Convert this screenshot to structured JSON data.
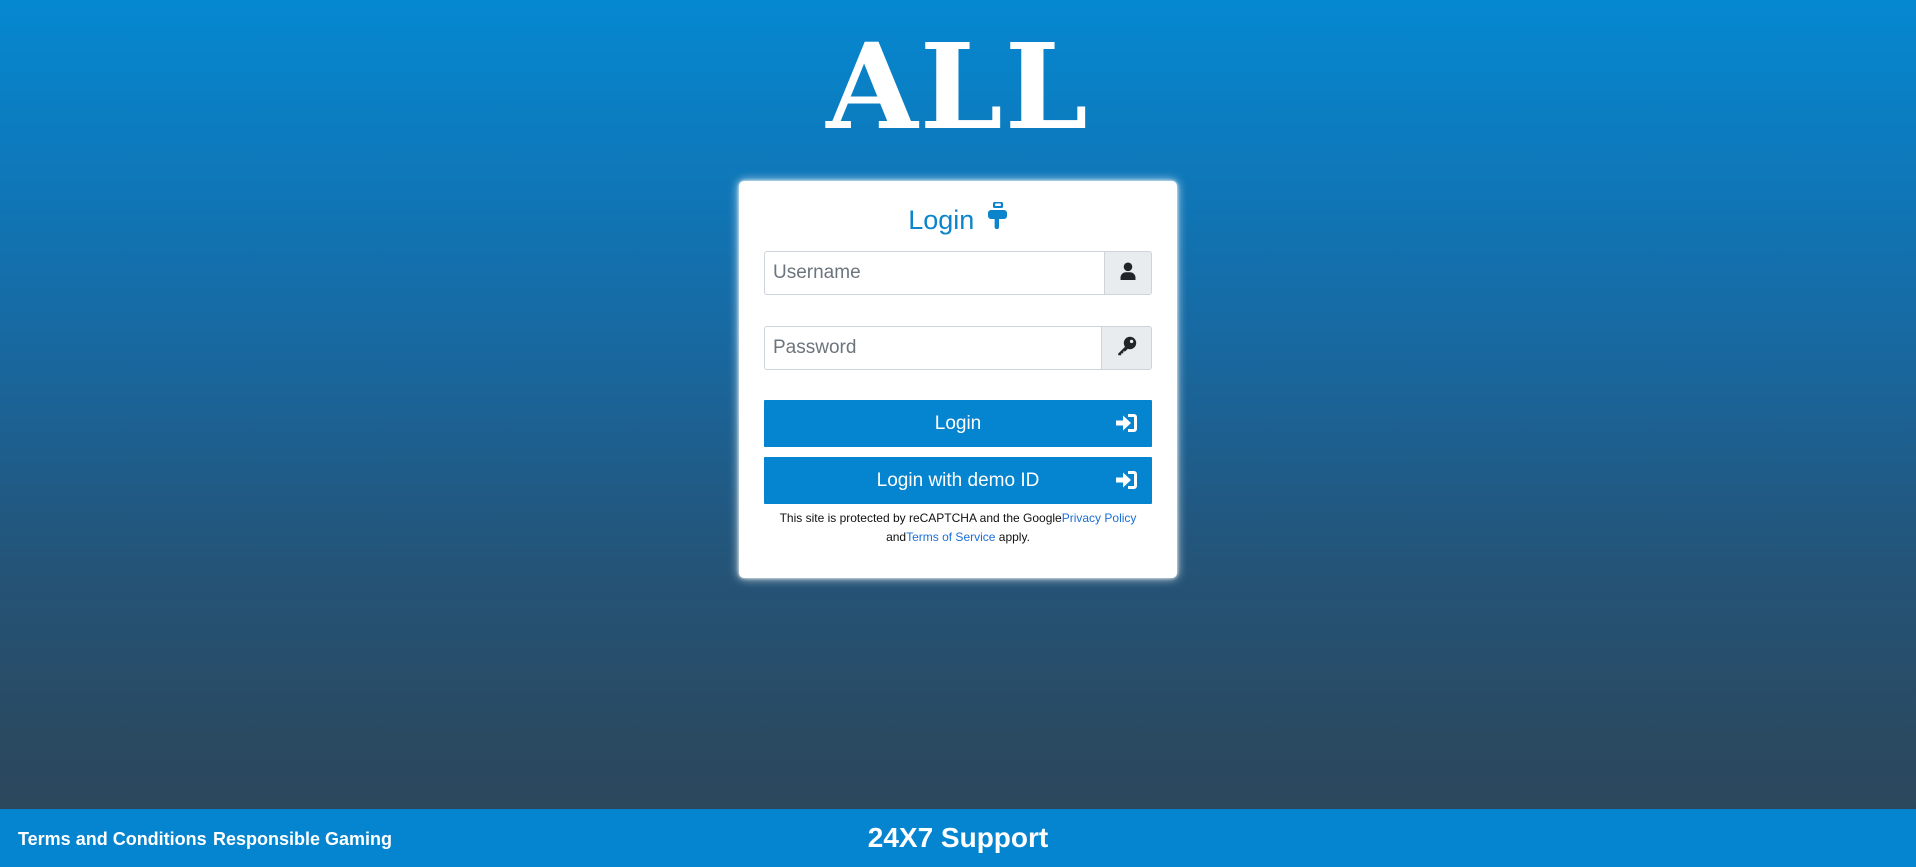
{
  "brand": {
    "logo_text": "ALL"
  },
  "login_card": {
    "title": "Login",
    "title_icon": "hand-pointing-down-icon",
    "username": {
      "placeholder": "Username",
      "value": "",
      "icon": "user-icon"
    },
    "password": {
      "placeholder": "Password",
      "value": "",
      "icon": "key-icon"
    },
    "login_button": {
      "label": "Login",
      "icon": "sign-in-icon"
    },
    "demo_button": {
      "label": "Login with demo ID",
      "icon": "sign-in-icon"
    },
    "recaptcha": {
      "prefix": "This site is protected by reCAPTCHA and the Google",
      "privacy_link": "Privacy Policy",
      "middle": " and",
      "terms_link": "Terms of Service",
      "suffix": " apply."
    }
  },
  "footer": {
    "links": [
      "Terms and Conditions",
      "Responsible Gaming"
    ],
    "support_text": "24X7 Support"
  },
  "colors": {
    "accent": "#0584cf",
    "link": "#1a6fd6",
    "background_top": "#0588d0",
    "background_bottom": "#2c4558"
  }
}
